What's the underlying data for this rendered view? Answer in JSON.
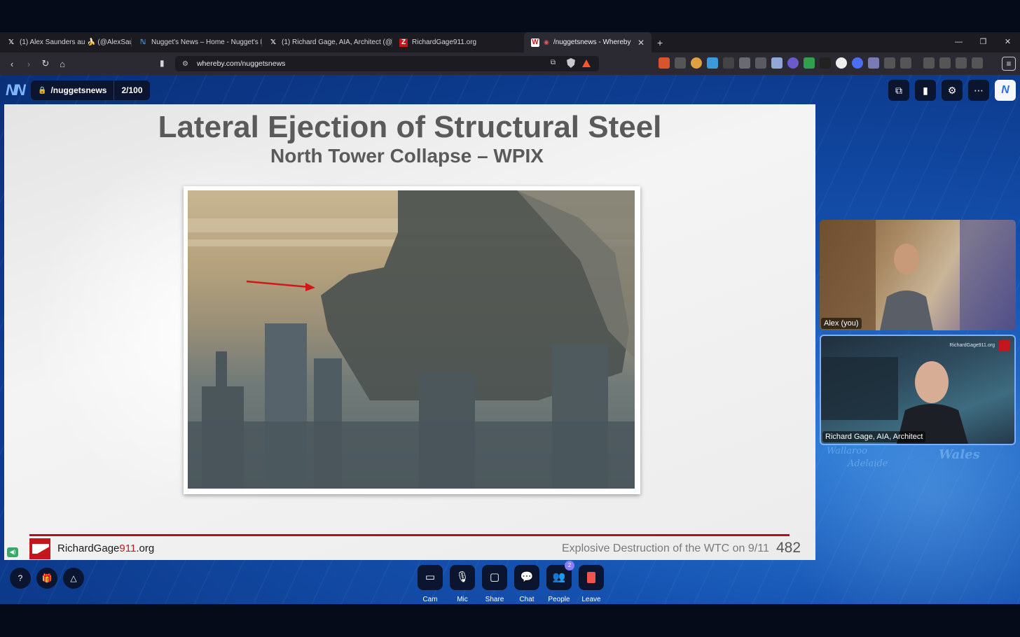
{
  "browser": {
    "tabs": [
      {
        "title": "(1) Alex Saunders au 🍌 (@AlexSaund",
        "icon": "x-logo-icon",
        "active": false
      },
      {
        "title": "Nugget's News – Home - Nugget's N",
        "icon": "nuggets-news-icon",
        "active": false
      },
      {
        "title": "(1) Richard Gage, AIA, Architect (@Ri",
        "icon": "x-logo-icon",
        "active": false
      },
      {
        "title": "RichardGage911.org",
        "icon": "rg911-icon",
        "active": false
      },
      {
        "title": "/nuggetsnews - Whereby",
        "icon": "whereby-icon",
        "active": true
      }
    ],
    "new_tab": "+",
    "window_controls": {
      "minimize": "—",
      "restore": "❐",
      "close": "✕"
    },
    "url": "whereby.com/nuggetsnews"
  },
  "whereby": {
    "logo": "NN",
    "room_name": "/nuggetsnews",
    "participant_count": "2/100",
    "top_buttons": [
      "picture-in-picture-icon",
      "stats-icon",
      "settings-icon",
      "more-icon",
      "brand-icon"
    ]
  },
  "slide": {
    "title": "Lateral Ejection of Structural Steel",
    "subtitle": "North Tower Collapse – WPIX",
    "footer_site_prefix": "RichardGage",
    "footer_site_highlight": "911",
    "footer_site_suffix": ".org",
    "footer_tagline": "Explosive Destruction of the WTC on 9/11",
    "slide_number": "482"
  },
  "participants": [
    {
      "name": "Alex (you)"
    },
    {
      "name": "Richard Gage, AIA, Architect",
      "watermark": "RichardGage911.org"
    }
  ],
  "controls": [
    {
      "label": "Cam",
      "icon": "camera-icon",
      "glyph": "▭"
    },
    {
      "label": "Mic",
      "icon": "microphone-icon",
      "glyph": "🎙"
    },
    {
      "label": "Share",
      "icon": "share-screen-icon",
      "glyph": "▢"
    },
    {
      "label": "Chat",
      "icon": "chat-icon",
      "glyph": "💬"
    },
    {
      "label": "People",
      "icon": "people-icon",
      "glyph": "👥",
      "badge": "2"
    },
    {
      "label": "Leave",
      "icon": "leave-icon",
      "glyph": ""
    }
  ],
  "left_controls": [
    {
      "icon": "help-icon",
      "glyph": "?"
    },
    {
      "icon": "gift-icon",
      "glyph": "🎁"
    },
    {
      "icon": "warning-icon",
      "glyph": "△"
    }
  ],
  "colors": {
    "brand_red": "#c4161c",
    "app_blue": "#1552b0",
    "pill_dark": "#0b1530",
    "leave_red": "#f1544a"
  }
}
